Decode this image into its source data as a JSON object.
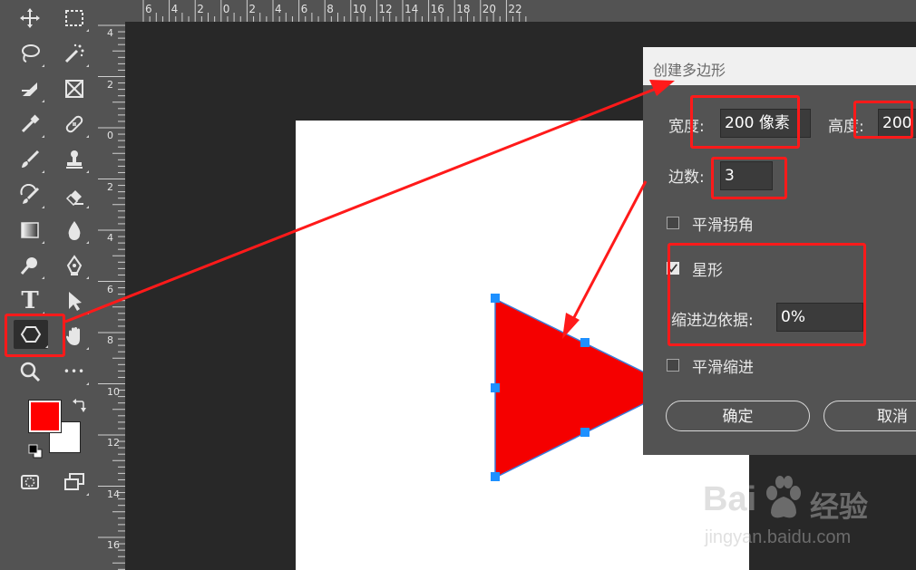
{
  "colors": {
    "foreground": "#ff0000",
    "background": "#ffffff",
    "annotation": "#ff1a1a",
    "shape_fill": "#f50000",
    "handle": "#1e90ff"
  },
  "toolbar": {
    "tools": [
      {
        "name": "move-tool-icon"
      },
      {
        "name": "marquee-tool-icon"
      },
      {
        "name": "lasso-tool-icon"
      },
      {
        "name": "magic-wand-tool-icon"
      },
      {
        "name": "crop-tool-icon"
      },
      {
        "name": "frame-tool-icon"
      },
      {
        "name": "eyedropper-tool-icon"
      },
      {
        "name": "healing-brush-tool-icon"
      },
      {
        "name": "brush-tool-icon"
      },
      {
        "name": "stamp-tool-icon"
      },
      {
        "name": "history-brush-tool-icon"
      },
      {
        "name": "eraser-tool-icon"
      },
      {
        "name": "gradient-tool-icon"
      },
      {
        "name": "blur-tool-icon"
      },
      {
        "name": "dodge-tool-icon"
      },
      {
        "name": "pen-tool-icon"
      },
      {
        "name": "type-tool-icon"
      },
      {
        "name": "path-selection-tool-icon"
      },
      {
        "name": "polygon-tool-icon"
      },
      {
        "name": "hand-tool-icon"
      },
      {
        "name": "zoom-tool-icon"
      },
      {
        "name": "more-tools-icon"
      }
    ],
    "type_tool_glyph": "T",
    "more_glyph": "•••"
  },
  "ruler": {
    "top_labels": [
      "6",
      "4",
      "2",
      "0",
      "2",
      "4",
      "6",
      "8",
      "10",
      "12",
      "14",
      "16",
      "18",
      "20",
      "22"
    ],
    "left_labels": [
      "4",
      "2",
      "0",
      "2",
      "4",
      "6",
      "8",
      "10",
      "12",
      "14",
      "16"
    ]
  },
  "dialog": {
    "title": "创建多边形",
    "width_label": "宽度:",
    "width_value": "200 像素",
    "height_label": "高度:",
    "height_value": "200",
    "sides_label": "边数:",
    "sides_value": "3",
    "smooth_corners_label": "平滑拐角",
    "smooth_corners_checked": false,
    "star_label": "星形",
    "star_checked": true,
    "indent_label": "缩进边依据:",
    "indent_value": "0%",
    "smooth_indent_label": "平滑缩进",
    "smooth_indent_checked": false,
    "ok_label": "确定",
    "cancel_label": "取消"
  },
  "watermark": {
    "brand_left": "Bai",
    "brand_right": "经验",
    "url": "jingyan.baidu.com"
  }
}
